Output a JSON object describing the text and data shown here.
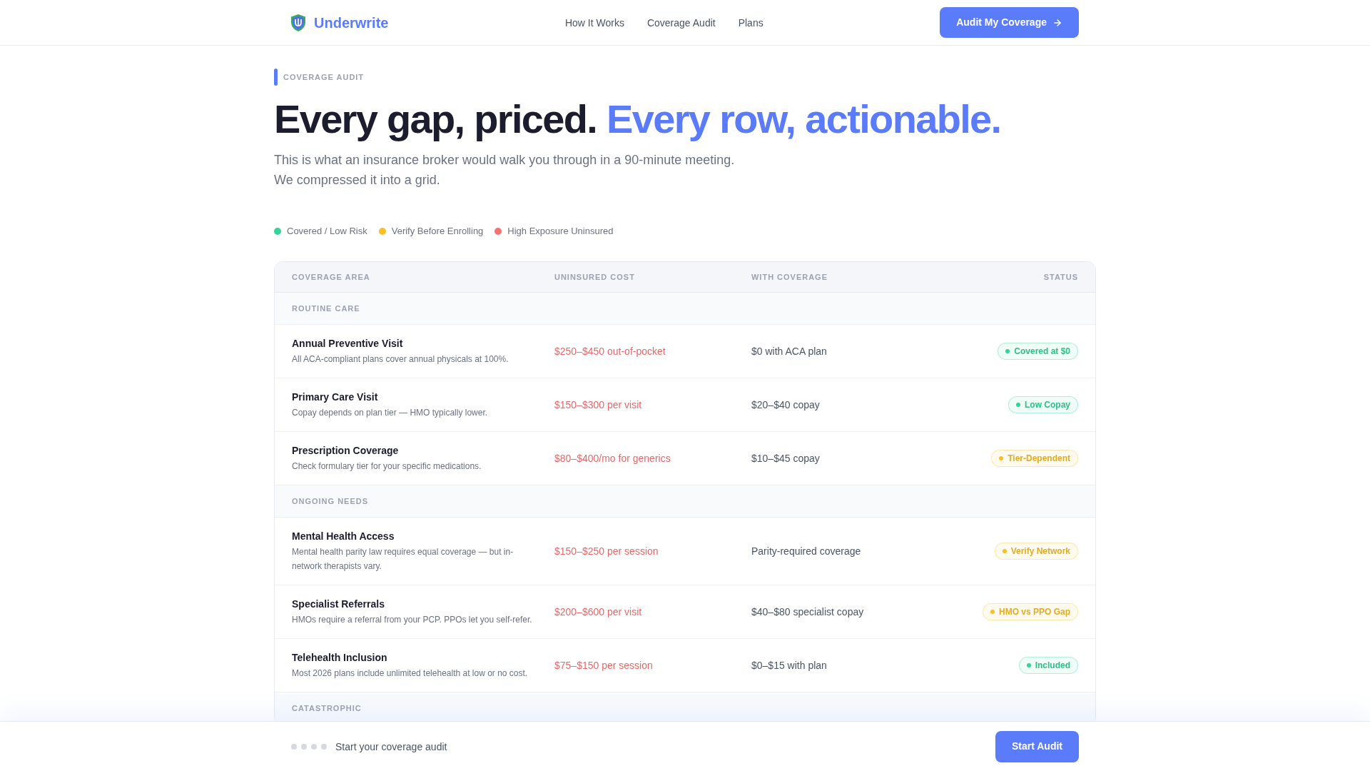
{
  "header": {
    "brand": "Underwrite",
    "nav": [
      "How It Works",
      "Coverage Audit",
      "Plans"
    ],
    "cta": "Audit My Coverage"
  },
  "hero": {
    "eyebrow": "COVERAGE AUDIT",
    "headline": [
      {
        "text": "Every gap, priced.",
        "kind": "dark"
      },
      {
        "text": "Every row, actionable.",
        "kind": "accent"
      }
    ],
    "subtitle": [
      "This is what an insurance broker would walk you through in a 90-minute meeting.",
      "We compressed it into a grid."
    ]
  },
  "legend": [
    {
      "label": "Covered / Low Risk",
      "color": "#34d399"
    },
    {
      "label": "Verify Before Enrolling",
      "color": "#fbbf24"
    },
    {
      "label": "High Exposure Uninsured",
      "color": "#f87171"
    }
  ],
  "table": {
    "columns": [
      "COVERAGE AREA",
      "UNINSURED COST",
      "WITH COVERAGE",
      "STATUS"
    ],
    "sections": [
      {
        "title": "ROUTINE CARE",
        "rows": [
          {
            "area": "Annual Preventive Visit",
            "note": "All ACA-compliant plans cover annual physicals at 100%.",
            "uninsured_cost": "$250–$450 out-of-pocket",
            "with_coverage": "$0 with ACA plan",
            "status": {
              "label": "Covered at $0",
              "color": "#34d399"
            }
          },
          {
            "area": "Primary Care Visit",
            "note": "Copay depends on plan tier — HMO typically lower.",
            "uninsured_cost": "$150–$300 per visit",
            "with_coverage": "$20–$40 copay",
            "status": {
              "label": "Low Copay",
              "color": "#34d399"
            }
          },
          {
            "area": "Prescription Coverage",
            "note": "Check formulary tier for your specific medications.",
            "uninsured_cost": "$80–$400/mo for generics",
            "with_coverage": "$10–$45 copay",
            "status": {
              "label": "Tier-Dependent",
              "color": "#fbbf24"
            }
          }
        ]
      },
      {
        "title": "ONGOING NEEDS",
        "rows": [
          {
            "area": "Mental Health Access",
            "note": "Mental health parity law requires equal coverage — but in-network therapists vary.",
            "uninsured_cost": "$150–$250 per session",
            "with_coverage": "Parity-required coverage",
            "status": {
              "label": "Verify Network",
              "color": "#fbbf24"
            }
          },
          {
            "area": "Specialist Referrals",
            "note": "HMOs require a referral from your PCP. PPOs let you self-refer.",
            "uninsured_cost": "$200–$600 per visit",
            "with_coverage": "$40–$80 specialist copay",
            "status": {
              "label": "HMO vs PPO Gap",
              "color": "#fbbf24"
            }
          },
          {
            "area": "Telehealth Inclusion",
            "note": "Most 2026 plans include unlimited telehealth at low or no cost.",
            "uninsured_cost": "$75–$150 per session",
            "with_coverage": "$0–$15 with plan",
            "status": {
              "label": "Included",
              "color": "#34d399"
            }
          }
        ]
      },
      {
        "title": "CATASTROPHIC"
      }
    ]
  },
  "bottom_bar": {
    "text": "Start your coverage audit",
    "button": "Start Audit"
  }
}
